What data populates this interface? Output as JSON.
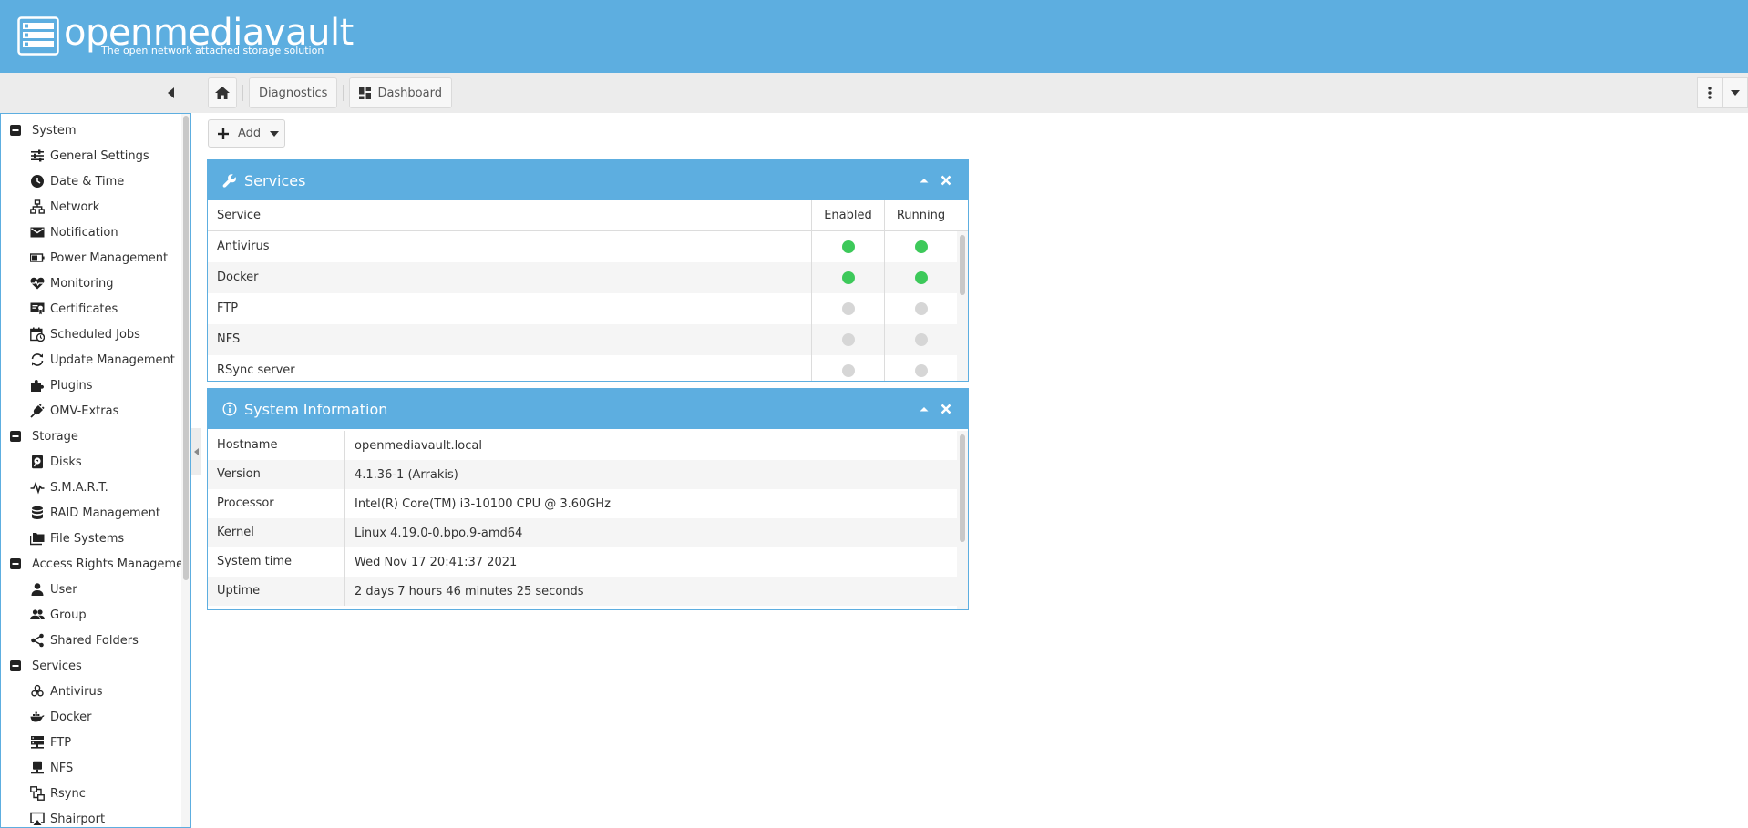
{
  "app": {
    "logo_text": "openmediavault",
    "tagline": "The open network attached storage solution"
  },
  "breadcrumbs": [
    {
      "label": "Diagnostics"
    },
    {
      "label": "Dashboard"
    }
  ],
  "toolbar": {
    "add_label": "Add"
  },
  "sidebar": {
    "groups": [
      {
        "label": "System",
        "items": [
          {
            "label": "General Settings",
            "icon": "sliders-icon"
          },
          {
            "label": "Date & Time",
            "icon": "clock-icon"
          },
          {
            "label": "Network",
            "icon": "network-icon"
          },
          {
            "label": "Notification",
            "icon": "mail-icon"
          },
          {
            "label": "Power Management",
            "icon": "battery-icon"
          },
          {
            "label": "Monitoring",
            "icon": "heart-pulse-icon"
          },
          {
            "label": "Certificates",
            "icon": "certificate-icon"
          },
          {
            "label": "Scheduled Jobs",
            "icon": "calendar-clock-icon"
          },
          {
            "label": "Update Management",
            "icon": "refresh-icon"
          },
          {
            "label": "Plugins",
            "icon": "puzzle-icon"
          },
          {
            "label": "OMV-Extras",
            "icon": "plug-icon"
          }
        ]
      },
      {
        "label": "Storage",
        "items": [
          {
            "label": "Disks",
            "icon": "disk-icon"
          },
          {
            "label": "S.M.A.R.T.",
            "icon": "pulse-icon"
          },
          {
            "label": "RAID Management",
            "icon": "database-icon"
          },
          {
            "label": "File Systems",
            "icon": "folders-icon"
          }
        ]
      },
      {
        "label": "Access Rights Management",
        "items": [
          {
            "label": "User",
            "icon": "user-icon"
          },
          {
            "label": "Group",
            "icon": "group-icon"
          },
          {
            "label": "Shared Folders",
            "icon": "share-icon"
          }
        ]
      },
      {
        "label": "Services",
        "items": [
          {
            "label": "Antivirus",
            "icon": "biohazard-icon"
          },
          {
            "label": "Docker",
            "icon": "docker-icon"
          },
          {
            "label": "FTP",
            "icon": "server-icon"
          },
          {
            "label": "NFS",
            "icon": "monitor-icon"
          },
          {
            "label": "Rsync",
            "icon": "sync-boxes-icon"
          },
          {
            "label": "Shairport",
            "icon": "airplay-icon"
          }
        ]
      }
    ]
  },
  "services_widget": {
    "title": "Services",
    "columns": {
      "service": "Service",
      "enabled": "Enabled",
      "running": "Running"
    },
    "rows": [
      {
        "name": "Antivirus",
        "enabled": true,
        "running": true
      },
      {
        "name": "Docker",
        "enabled": true,
        "running": true
      },
      {
        "name": "FTP",
        "enabled": false,
        "running": false
      },
      {
        "name": "NFS",
        "enabled": false,
        "running": false
      },
      {
        "name": "RSync server",
        "enabled": false,
        "running": false
      }
    ]
  },
  "sysinfo_widget": {
    "title": "System Information",
    "rows": [
      {
        "key": "Hostname",
        "value": "openmediavault.local"
      },
      {
        "key": "Version",
        "value": "4.1.36-1 (Arrakis)"
      },
      {
        "key": "Processor",
        "value": "Intel(R) Core(TM) i3-10100 CPU @ 3.60GHz"
      },
      {
        "key": "Kernel",
        "value": "Linux 4.19.0-0.bpo.9-amd64"
      },
      {
        "key": "System time",
        "value": "Wed Nov 17 20:41:37 2021"
      },
      {
        "key": "Uptime",
        "value": "2 days 7 hours 46 minutes 25 seconds"
      }
    ]
  },
  "colors": {
    "brand": "#5daee0",
    "status_on": "#3dc95a",
    "status_off": "#d6d6d6"
  }
}
